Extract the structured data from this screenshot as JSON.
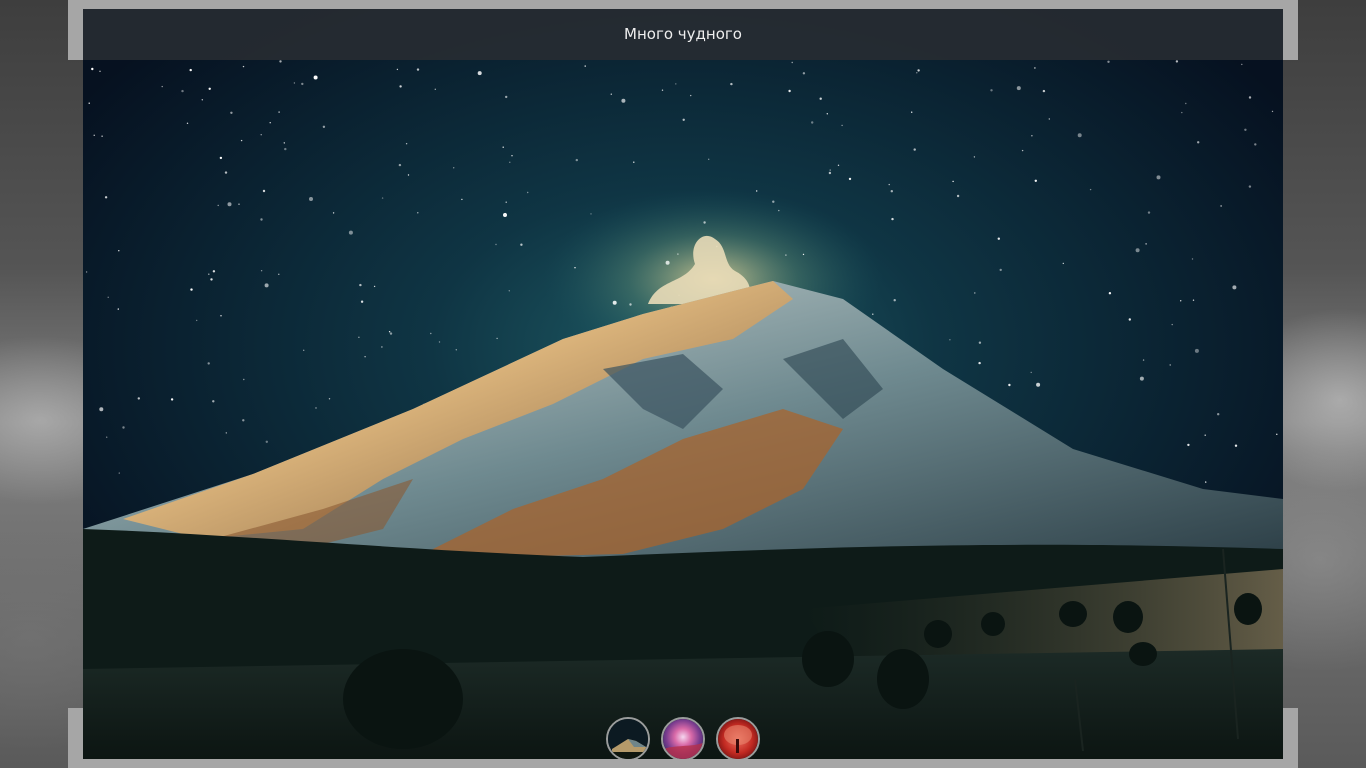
{
  "gallery": {
    "title": "Много чудного",
    "active_index": 0,
    "images": [
      {
        "icon": "mountain-night-thumbnail"
      },
      {
        "icon": "pink-nebula-thumbnail"
      },
      {
        "icon": "red-tree-thumbnail"
      }
    ]
  },
  "colors": {
    "title_bar": "#282c32",
    "frame": "#a6a6a6",
    "sky": "#071320",
    "thumb_border": "#bebebe"
  }
}
